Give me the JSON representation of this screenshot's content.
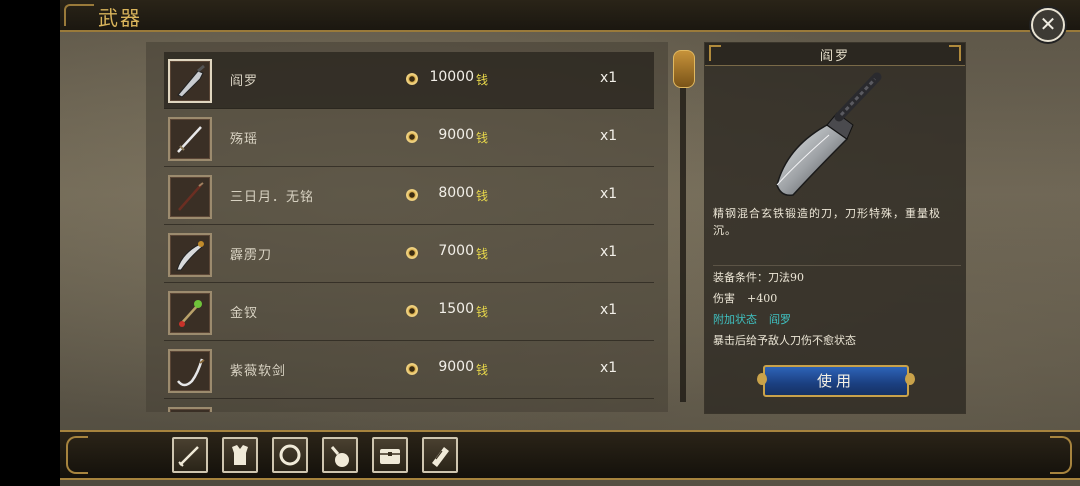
{
  "window": {
    "title": "武器"
  },
  "items": [
    {
      "name": "阎罗",
      "price": "10000",
      "currency": "钱",
      "qty": "x1",
      "icon": "broadsword-icon",
      "selected": true
    },
    {
      "name": "殇瑶",
      "price": "9000",
      "currency": "钱",
      "qty": "x1",
      "icon": "sword-icon",
      "selected": false
    },
    {
      "name": "三日月．无铭",
      "price": "8000",
      "currency": "钱",
      "qty": "x1",
      "icon": "spear-icon",
      "selected": false
    },
    {
      "name": "霹雳刀",
      "price": "7000",
      "currency": "钱",
      "qty": "x1",
      "icon": "curved-blade-icon",
      "selected": false
    },
    {
      "name": "金钗",
      "price": "1500",
      "currency": "钱",
      "qty": "x1",
      "icon": "hairpin-icon",
      "selected": false
    },
    {
      "name": "紫薇软剑",
      "price": "9000",
      "currency": "钱",
      "qty": "x1",
      "icon": "soft-sword-icon",
      "selected": false
    }
  ],
  "detail": {
    "title": "阎罗",
    "description": "精钢混合玄铁锻造的刀，刀形特殊，重量极沉。",
    "requirement_label": "装备条件：",
    "requirement_value": "刀法90",
    "damage_label": "伤害",
    "damage_value": "+400",
    "status_label": "附加状态",
    "status_value": "阎罗",
    "effect": "暴击后给予敌人刀伤不愈状态",
    "use_button": "使用"
  },
  "categories": [
    {
      "icon": "weapon-category-icon"
    },
    {
      "icon": "armor-category-icon"
    },
    {
      "icon": "ring-category-icon"
    },
    {
      "icon": "potion-category-icon"
    },
    {
      "icon": "chest-category-icon"
    },
    {
      "icon": "scroll-category-icon"
    }
  ],
  "colors": {
    "accent_gold": "#d9b45b",
    "currency_yellow": "#e8d84a",
    "status_teal": "#3fc2c2",
    "button_blue": "#2d63b8"
  }
}
